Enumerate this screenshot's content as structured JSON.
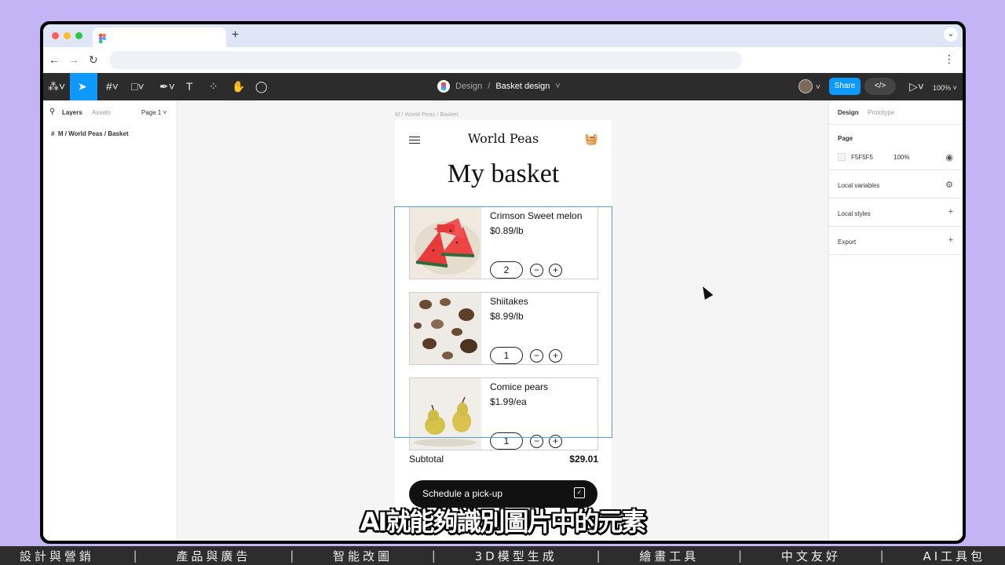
{
  "figma": {
    "breadcrumb_section": "Design",
    "file_name": "Basket design",
    "share_label": "Share",
    "zoom": "100%",
    "layers_tab": "Layers",
    "assets_tab": "Assets",
    "page_selector": "Page 1",
    "layer_item": "M / World Peas / Basket",
    "frame_label": "M / World Peas / Basket",
    "design_tab": "Design",
    "prototype_tab": "Prototype",
    "page_section": "Page",
    "page_color": "F5F5F5",
    "page_opacity": "100%",
    "local_variables": "Local variables",
    "local_styles": "Local styles",
    "export": "Export"
  },
  "app": {
    "brand": "World Peas",
    "title": "My basket",
    "items": [
      {
        "name": "Crimson Sweet melon",
        "price": "$0.89/lb",
        "qty": "2"
      },
      {
        "name": "Shiitakes",
        "price": "$8.99/lb",
        "qty": "1"
      },
      {
        "name": "Comice pears",
        "price": "$1.99/ea",
        "qty": "1"
      }
    ],
    "subtotal_label": "Subtotal",
    "subtotal_value": "$29.01",
    "cta_label": "Schedule a pick-up"
  },
  "subtitle": "AI就能夠識別圖片中的元素",
  "categories": [
    "設計與營銷",
    "產品與廣告",
    "智能改圖",
    "3D模型生成",
    "繪畫工具",
    "中文友好",
    "AI工具包"
  ],
  "colors": {
    "accent": "#0d99ff",
    "selection": "#4da3d9",
    "background": "#c4b3f5"
  }
}
